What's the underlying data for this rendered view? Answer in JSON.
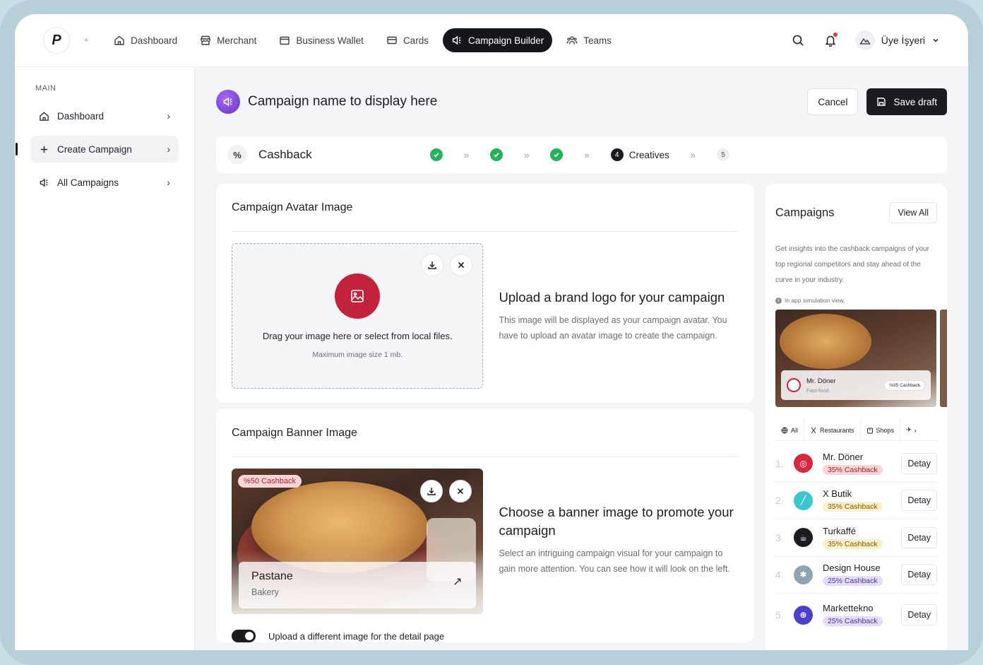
{
  "nav": {
    "items": [
      {
        "label": "Dashboard",
        "icon": "home-icon"
      },
      {
        "label": "Merchant",
        "icon": "store-icon"
      },
      {
        "label": "Business Wallet",
        "icon": "wallet-icon"
      },
      {
        "label": "Cards",
        "icon": "card-icon"
      },
      {
        "label": "Campaign Builder",
        "icon": "megaphone-icon",
        "active": true
      },
      {
        "label": "Teams",
        "icon": "team-icon"
      }
    ],
    "user_name": "Üye İşyeri"
  },
  "sidebar": {
    "heading": "MAIN",
    "items": [
      {
        "label": "Dashboard"
      },
      {
        "label": "Create Campaign",
        "active": true
      },
      {
        "label": "All Campaigns"
      }
    ]
  },
  "header": {
    "title": "Campaign name to display here",
    "cancel_label": "Cancel",
    "save_label": "Save draft"
  },
  "stepper": {
    "icon_glyph": "%",
    "title": "Cashback",
    "current_step_number": "4",
    "current_step_label": "Creatives",
    "next_step_number": "5",
    "arrow_glyph": "»"
  },
  "avatar_section": {
    "title": "Campaign Avatar Image",
    "drop_text": "Drag your image here or select from local files.",
    "drop_sub": "Maximum image size 1 mb.",
    "info_title": "Upload a brand logo for your campaign",
    "info_text": "This image will be displayed as your campaign avatar. You have to upload an avatar image to create the campaign."
  },
  "banner_section": {
    "title": "Campaign Banner Image",
    "badge": "%50 Cashback",
    "preview_title": "Pastane",
    "preview_sub": "Bakery",
    "info_title": "Choose a banner image to promote your campaign",
    "info_text": "Select an intriguing campaign visual for your campaign to gain more attention. You can see how it will look on the left.",
    "toggle_label": "Upload a different image for the detail page",
    "toggle_on": true
  },
  "campaigns_panel": {
    "title": "Campaigns",
    "view_all_label": "View All",
    "description": "Get insights into the cashback campaigns of your top regional competitors and stay ahead of the curve in your industry.",
    "sim_note": "In app simulation view.",
    "preview": {
      "name": "Mr. Döner",
      "category": "Fast-food",
      "cashback": "%35 Cashback"
    },
    "filters": [
      {
        "label": "All",
        "icon": "globe-icon"
      },
      {
        "label": "Restaurants",
        "icon": "utensils-icon"
      },
      {
        "label": "Shops",
        "icon": "bag-icon"
      }
    ],
    "detail_label": "Detay",
    "list": [
      {
        "rank": "1.",
        "name": "Mr. Döner",
        "cashback": "35% Cashback",
        "badge_bg": "#fbd5d5",
        "badge_fg": "#a11b2f",
        "logo_bg": "#d8283f"
      },
      {
        "rank": "2.",
        "name": "X Butik",
        "cashback": "35% Cashback",
        "badge_bg": "#fbf0c8",
        "badge_fg": "#7a5a00",
        "logo_bg": "#3cc6cf"
      },
      {
        "rank": "3.",
        "name": "Turkaffé",
        "cashback": "35% Cashback",
        "badge_bg": "#fbf0c8",
        "badge_fg": "#7a5a00",
        "logo_bg": "#1a1c21"
      },
      {
        "rank": "4.",
        "name": "Design House",
        "cashback": "25% Cashback",
        "badge_bg": "#e4dcfb",
        "badge_fg": "#4a2ea6",
        "logo_bg": "#8fa4b0"
      },
      {
        "rank": "5.",
        "name": "Markettekno",
        "cashback": "25% Cashback",
        "badge_bg": "#e4dcfb",
        "badge_fg": "#4a2ea6",
        "logo_bg": "#4a3fd1"
      }
    ]
  }
}
